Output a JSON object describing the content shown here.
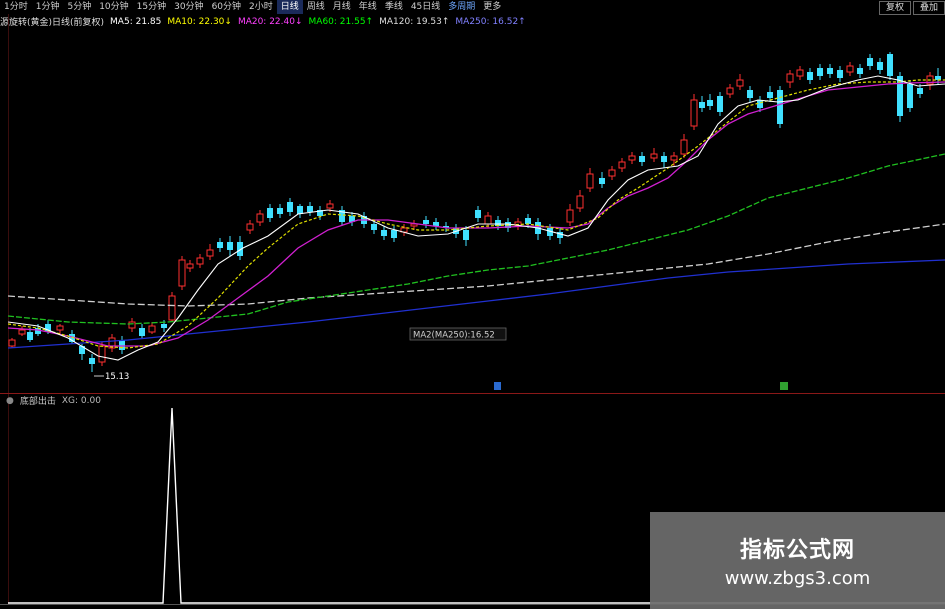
{
  "toolbar": {
    "tabs": [
      {
        "label": "1分时"
      },
      {
        "label": "1分钟"
      },
      {
        "label": "5分钟"
      },
      {
        "label": "10分钟"
      },
      {
        "label": "15分钟"
      },
      {
        "label": "30分钟"
      },
      {
        "label": "60分钟"
      },
      {
        "label": "2小时"
      },
      {
        "label": "日线"
      },
      {
        "label": "周线"
      },
      {
        "label": "月线"
      },
      {
        "label": "年线"
      },
      {
        "label": "季线"
      },
      {
        "label": "45日线"
      },
      {
        "label": "多周期"
      },
      {
        "label": "更多"
      }
    ],
    "active_tab": "日线",
    "right_buttons": [
      "复权",
      "叠加"
    ]
  },
  "ma_legend": {
    "prefix": "源旋转(黄金)日线(前复权)",
    "items": [
      {
        "label": "MA5: 21.85",
        "color": "#ffffff"
      },
      {
        "label": "MA10: 22.30↓",
        "color": "#ffff00"
      },
      {
        "label": "MA20: 22.40↓",
        "color": "#ff40ff"
      },
      {
        "label": "MA60: 21.55↑",
        "color": "#00ff00"
      },
      {
        "label": "MA120: 19.53↑",
        "color": "#dddddd"
      },
      {
        "label": "MA250: 16.52↑",
        "color": "#6060ff"
      }
    ]
  },
  "price_labels": {
    "low_marker": "15.13",
    "ma250_tag": "MA2(MA250):16.52"
  },
  "indicator": {
    "name": "底部出击",
    "value": "XG: 0.00"
  },
  "watermark": {
    "line1": "指标公式网",
    "line2": "www.zbgs3.com"
  },
  "colors": {
    "up": "#ff3030",
    "down": "#40e0ff",
    "ma5": "#ffffff",
    "ma10": "#e0e000",
    "ma20": "#d020d0",
    "ma60": "#20c020",
    "ma120": "#d0d0d0",
    "ma250": "#2030d0"
  }
}
